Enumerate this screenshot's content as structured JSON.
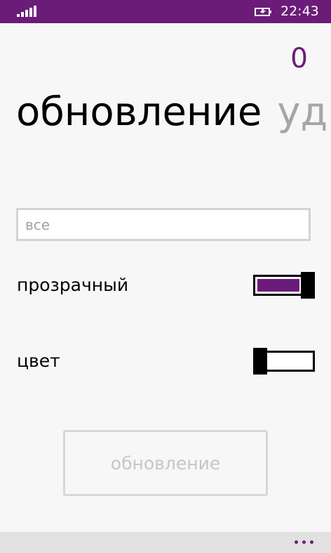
{
  "status_bar": {
    "time": "22:43",
    "background_color": "#6b1c78"
  },
  "header": {
    "counter": "0"
  },
  "pivot": {
    "active_label": "обновление",
    "next_label_partial": "уд"
  },
  "search": {
    "placeholder": "все"
  },
  "settings": {
    "transparent_label": "прозрачный",
    "transparent_enabled": true,
    "color_label": "цвет",
    "color_enabled": false
  },
  "actions": {
    "update_label": "обновление"
  },
  "colors": {
    "accent": "#6b1c78"
  },
  "icons": {
    "signal": "signal-bars-icon",
    "battery": "battery-charging-icon",
    "more": "more-icon"
  }
}
